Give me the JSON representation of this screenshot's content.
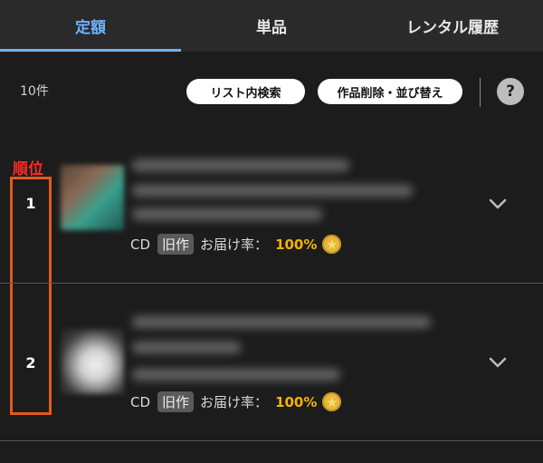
{
  "tabs": [
    {
      "label": "定額",
      "active": true
    },
    {
      "label": "単品",
      "active": false
    },
    {
      "label": "レンタル履歴",
      "active": false
    }
  ],
  "toolbar": {
    "count": "10件",
    "search_label": "リスト内検索",
    "edit_label": "作品削除・並び替え",
    "help_label": "?"
  },
  "rank_annotation": {
    "title": "順位",
    "color": "#ff2a2a",
    "box_color": "#e25a1c"
  },
  "items": [
    {
      "rank": "1",
      "format": "CD",
      "tag": "旧作",
      "rate_label": "お届け率：",
      "rate": "100%",
      "icon": "star-icon"
    },
    {
      "rank": "2",
      "format": "CD",
      "tag": "旧作",
      "rate_label": "お届け率：",
      "rate": "100%",
      "icon": "star-icon"
    }
  ],
  "colors": {
    "accent": "#6fb1ff",
    "rate": "#f2b400"
  }
}
